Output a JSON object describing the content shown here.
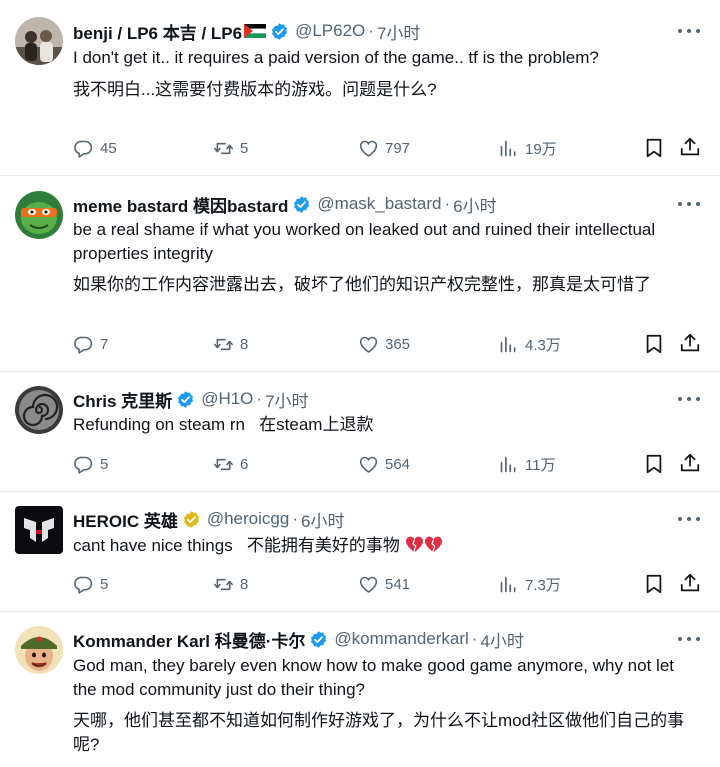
{
  "tweets": [
    {
      "name": "benji / LP6 本吉 / LP6",
      "handle": "@LP62O",
      "sep": "·",
      "time": "7小时",
      "text1": "I don't get it.. it requires a paid version of the game.. tf is the problem?",
      "text2": "我不明白...这需要付费版本的游戏。问题是什么?",
      "replies": "45",
      "retweets": "5",
      "likes": "797",
      "views": "19万"
    },
    {
      "name": "meme bastard 模因bastard",
      "handle": "@mask_bastard",
      "sep": "·",
      "time": "6小时",
      "text1": "be a real shame if what you worked on leaked out and ruined their intellectual properties integrity",
      "text2": "如果你的工作内容泄露出去，破坏了他们的知识产权完整性，那真是太可惜了",
      "replies": "7",
      "retweets": "8",
      "likes": "365",
      "views": "4.3万"
    },
    {
      "name": "Chris 克里斯",
      "handle": "@H1O",
      "sep": "·",
      "time": "7小时",
      "text1": "Refunding on steam rn   在steam上退款",
      "replies": "5",
      "retweets": "6",
      "likes": "564",
      "views": "11万"
    },
    {
      "name": "HEROIC 英雄",
      "handle": "@heroicgg",
      "sep": "·",
      "time": "6小时",
      "text1": "cant have nice things   不能拥有美好的事物",
      "replies": "5",
      "retweets": "8",
      "likes": "541",
      "views": "7.3万"
    },
    {
      "name": "Kommander Karl 科曼德·卡尔",
      "handle": "@kommanderkarl",
      "sep": "·",
      "time": "4小时",
      "text1": "God man, they barely even know how to make good game anymore, why not let the mod community just do their thing?",
      "text2": "天哪，他们甚至都不知道如何制作好游戏了，为什么不让mod社区做他们自己的事呢?"
    }
  ],
  "colors": {
    "verified_blue": "#1d9bf0",
    "verified_gold": "#e2b719",
    "secondary_text": "#536471",
    "divider": "#e6e9eb"
  },
  "icons": {
    "reply": "reply-icon",
    "retweet": "retweet-icon",
    "like": "heart-icon",
    "views": "views-icon",
    "bookmark": "bookmark-icon",
    "share": "share-icon",
    "more": "more-icon"
  }
}
